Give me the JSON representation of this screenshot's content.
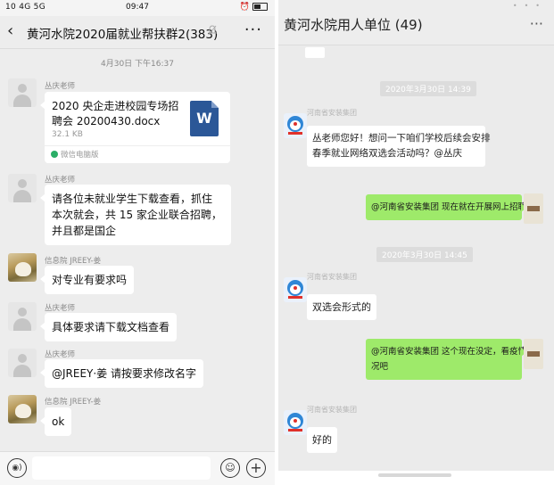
{
  "left": {
    "status": {
      "left": "10 4G 5G",
      "time": "09:47",
      "right": "⏰"
    },
    "chat_title": "黄河水院2020届就业帮扶群2(383)",
    "more": "···",
    "back": "‹",
    "timestamp": "4月30日 下午16:37",
    "messages": [
      {
        "sender": "丛庆老师",
        "type": "file",
        "file_name": "2020 央企走进校园专场招聘会 20200430.docx",
        "file_size": "32.1 KB",
        "source": "微信电脑版",
        "icon": "word-icon",
        "icon_letter": "W"
      },
      {
        "sender": "丛庆老师",
        "text_lines": [
          "请各位未就业学生下载查看，抓住",
          "本次就会，共 15 家企业联合招聘，",
          "并且都是国企"
        ]
      },
      {
        "sender": "信息院 JREEY-姜",
        "text": "对专业有要求吗"
      },
      {
        "sender": "丛庆老师",
        "text": "具体要求请下载文档查看"
      },
      {
        "sender": "丛庆老师",
        "text": "@JREEY·姜  请按要求修改名字"
      },
      {
        "sender": "信息院 JREEY-姜",
        "text": "ok"
      }
    ],
    "input": {
      "voice": "◉)",
      "emoji": "☺",
      "plus": "+"
    }
  },
  "right": {
    "chat_title": "黄河水院用人单位 (49)",
    "more": "···",
    "ts1": "2020年3月30日 14:39",
    "ts2": "2020年3月30日 14:45",
    "sender": "河南省安装集团",
    "msg1_lines": [
      "丛老师您好！想问一下咱们学校后续会安排",
      "春季就业网络双选会活动吗？@丛庆"
    ],
    "green1": "@河南省安装集团 现在就在开展网上招聘呀",
    "msg2": "双选会形式的",
    "green2_lines": [
      "@河南省安装集团 这个现在没定，看疫情情",
      "况吧"
    ],
    "msg3": "好的"
  }
}
